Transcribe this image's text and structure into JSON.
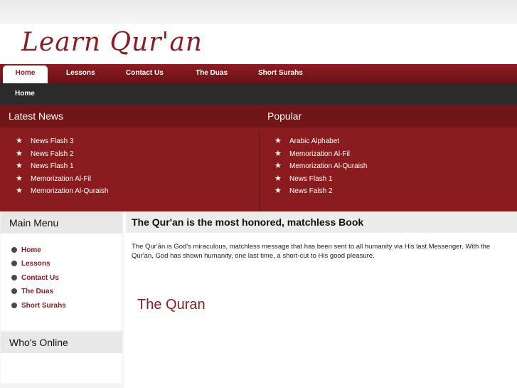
{
  "site": {
    "logo_text": "Learn Qur'an"
  },
  "nav": {
    "items": [
      {
        "label": "Home",
        "active": true
      },
      {
        "label": "Lessons"
      },
      {
        "label": "Contact Us"
      },
      {
        "label": "The Duas"
      },
      {
        "label": "Short Surahs"
      }
    ]
  },
  "breadcrumb": {
    "current": "Home"
  },
  "latest_news": {
    "title": "Latest News",
    "items": [
      "News Flash 3",
      "News Falsh 2",
      "News Flash 1",
      "Memorization Al-Fil",
      "Memorization Al-Quraish"
    ]
  },
  "popular": {
    "title": "Popular",
    "items": [
      "Arabic Alphabet",
      "Memorization Al-Fil",
      "Memorization Al-Quraish",
      "News Flash 1",
      "News Falsh 2"
    ]
  },
  "main_menu": {
    "title": "Main Menu",
    "items": [
      "Home",
      "Lessons",
      "Contact Us",
      "The Duas",
      "Short Surahs"
    ]
  },
  "whos_online": {
    "title": "Who's Online"
  },
  "article": {
    "title": "The Qur'an is the most honored, matchless Book",
    "body": "The Qur'ān is God's miraculous, matchless message that has been sent to all humanity via His last Messenger. With the Qur'an, God has shown humanity, one last time, a short-cut to His good pleasure.",
    "subheading": "The Quran"
  },
  "colors": {
    "brand": "#8a1c22",
    "nav_bg": "#7a171b",
    "breadcrumb_bg": "#2b2b2b"
  },
  "icons": {
    "news_bullet": "star-icon",
    "menu_bullet": "dot-icon"
  }
}
